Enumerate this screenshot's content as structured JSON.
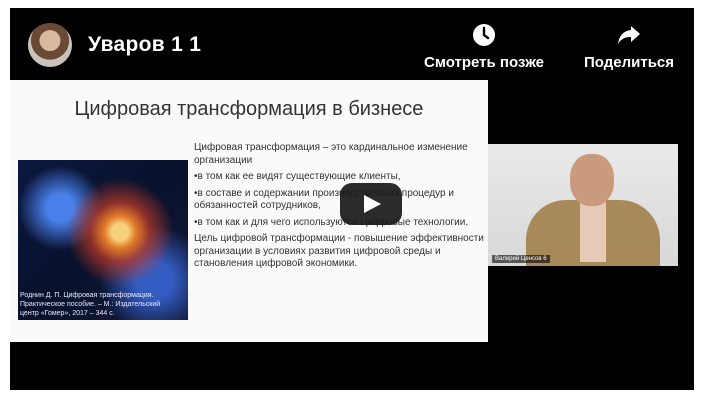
{
  "video": {
    "title": "Уваров 1 1"
  },
  "actions": {
    "watch_later": "Смотреть позже",
    "share": "Поделиться"
  },
  "slide": {
    "title": "Цифровая трансформация в бизнесе",
    "image_caption": "Роднин Д. П. Цифровая трансформация. Практическое пособие. – М.: Издательский центр «Гомер», 2017 – 344 с.",
    "paragraphs": [
      "Цифровая трансформация – это кардинальное изменение организации",
      "•в том как ее видят существующие клиенты,",
      "•в составе и содержании производственных процедур и обязанностей сотрудников,",
      "•в том как и для чего используются Цифровые технологии.",
      "Цель цифровой трансформации - повышение эффективности организации в условиях развития цифровой среды и становления цифровой экономики."
    ]
  },
  "camera": {
    "label": "Валерий Ценсов 6"
  }
}
